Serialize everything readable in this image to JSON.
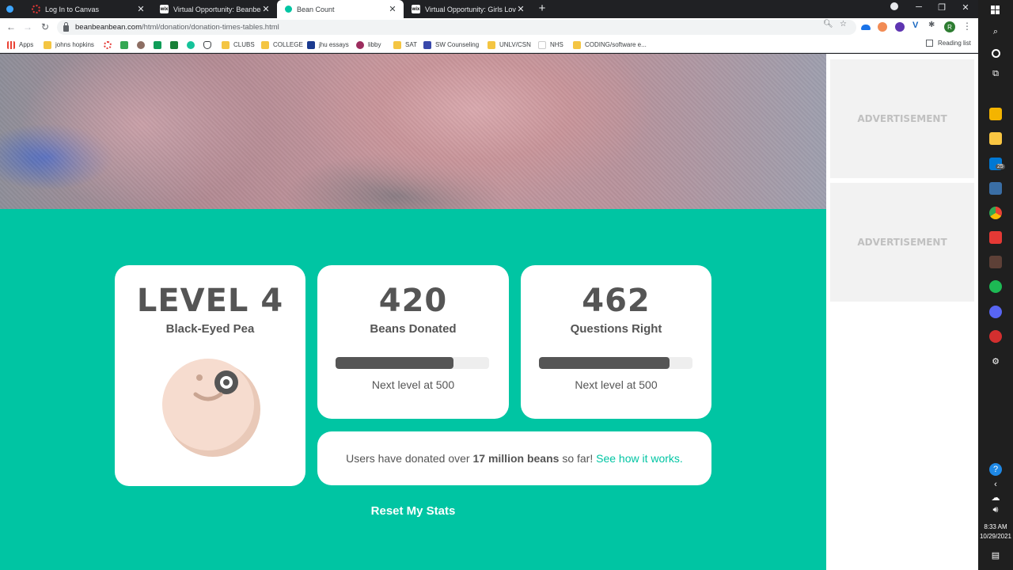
{
  "browser": {
    "tabs": [
      {
        "title": "Log In to Canvas",
        "favicon": "canvas-icon",
        "active": false
      },
      {
        "title": "Virtual Opportunity: Beanbeanbe",
        "favicon": "wix-icon",
        "active": false
      },
      {
        "title": "Bean Count",
        "favicon": "bean-icon",
        "active": true
      },
      {
        "title": "Virtual Opportunity: Girls Love M",
        "favicon": "wix-icon",
        "active": false
      }
    ],
    "url_host": "beanbeanbean.com",
    "url_path": "/html/donation/donation-times-tables.html",
    "profile_initial": "R",
    "bookmarks": [
      {
        "label": "Apps",
        "icon": "apps-grid-icon"
      },
      {
        "label": "johns hopkins",
        "icon": "folder-icon"
      },
      {
        "label": "",
        "icon": "canvas-icon"
      },
      {
        "label": "",
        "icon": "c-green-icon"
      },
      {
        "label": "",
        "icon": "coffee-icon"
      },
      {
        "label": "",
        "icon": "mail-icon"
      },
      {
        "label": "",
        "icon": "mail-icon"
      },
      {
        "label": "",
        "icon": "grammarly-icon"
      },
      {
        "label": "",
        "icon": "shield-icon"
      },
      {
        "label": "CLUBS",
        "icon": "folder-icon"
      },
      {
        "label": "COLLEGE",
        "icon": "folder-icon"
      },
      {
        "label": "jhu essays",
        "icon": "jhu-icon"
      },
      {
        "label": "libby",
        "icon": "libby-icon"
      },
      {
        "label": "SAT",
        "icon": "folder-icon"
      },
      {
        "label": "SW Counseling",
        "icon": "sw-icon"
      },
      {
        "label": "UNLV/CSN",
        "icon": "folder-icon"
      },
      {
        "label": "NHS",
        "icon": "wix-icon"
      },
      {
        "label": "CODING/software e...",
        "icon": "folder-icon"
      }
    ],
    "reading_list": "Reading list"
  },
  "stats": {
    "level": {
      "title": "LEVEL 4",
      "name": "Black-Eyed Pea"
    },
    "beans": {
      "value": "420",
      "label": "Beans Donated",
      "progress": 0.77,
      "next": "Next level at 500"
    },
    "questions": {
      "value": "462",
      "label": "Questions Right",
      "progress": 0.85,
      "next": "Next level at 500"
    }
  },
  "donation": {
    "prefix": "Users have donated over",
    "amount": "17 million beans",
    "suffix": "so far!",
    "link": "See how it works."
  },
  "reset_label": "Reset My Stats",
  "ads": [
    "ADVERTISEMENT",
    "ADVERTISEMENT"
  ],
  "taskbar": {
    "mail_badge": "25",
    "time": "8:33 AM",
    "date": "10/29/2021"
  },
  "colors": {
    "teal": "#00c5a3",
    "card_text": "#555555",
    "bean": "#f6dccf"
  }
}
